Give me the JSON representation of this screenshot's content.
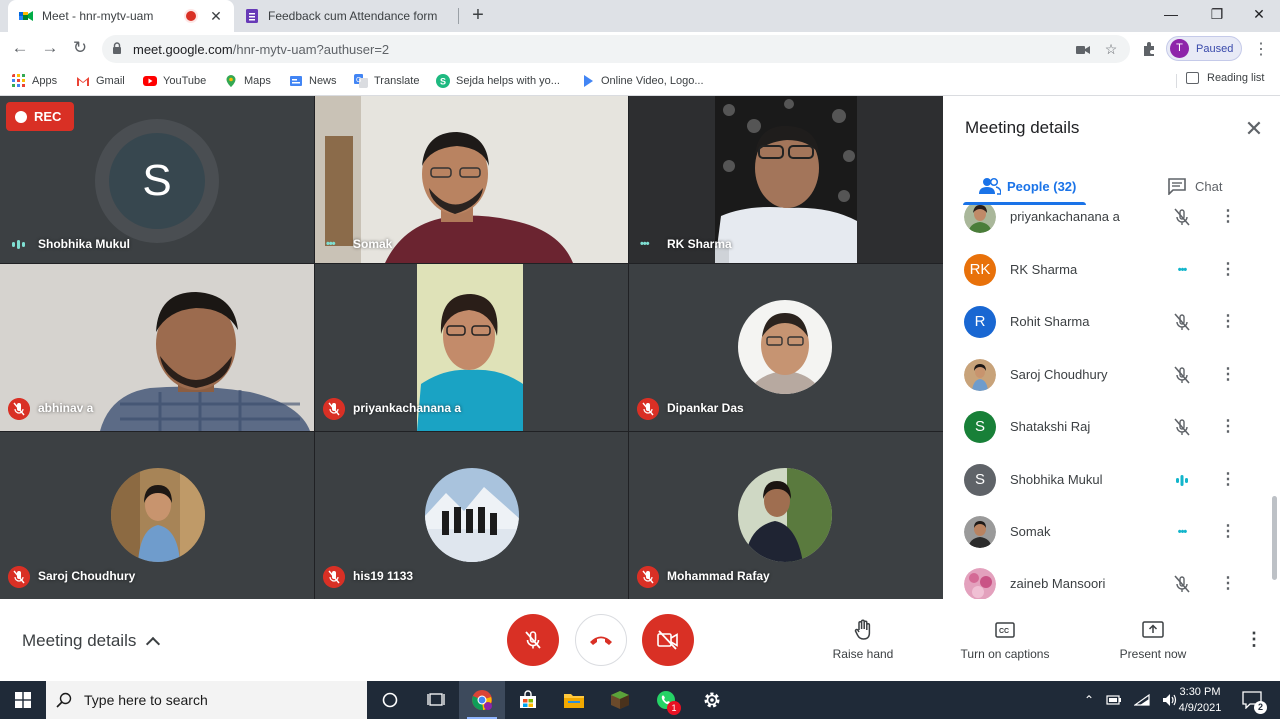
{
  "browser": {
    "tabs": [
      {
        "title": "Meet - hnr-mytv-uam",
        "recording": true
      },
      {
        "title": "Feedback cum Attendance form"
      }
    ],
    "url_host": "meet.google.com",
    "url_path": "/hnr-mytv-uam?authuser=2",
    "profile_initial": "T",
    "profile_status": "Paused",
    "bookmarks": [
      {
        "label": "Apps",
        "icon": "apps-grid-icon"
      },
      {
        "label": "Gmail",
        "icon": "gmail-icon"
      },
      {
        "label": "YouTube",
        "icon": "youtube-icon"
      },
      {
        "label": "Maps",
        "icon": "maps-pin-icon"
      },
      {
        "label": "News",
        "icon": "news-icon"
      },
      {
        "label": "Translate",
        "icon": "translate-icon"
      },
      {
        "label": "Sejda helps with yo...",
        "icon": "sejda-icon"
      },
      {
        "label": "Online Video, Logo...",
        "icon": "play-icon"
      }
    ],
    "reading_list": "Reading list"
  },
  "meet": {
    "rec_label": "REC",
    "tiles": [
      {
        "name": "Shobhika Mukul",
        "initial": "S",
        "status": "speaking"
      },
      {
        "name": "Somak",
        "status": "dots"
      },
      {
        "name": "RK Sharma",
        "status": "dots"
      },
      {
        "name": "abhinav a",
        "status": "muted"
      },
      {
        "name": "priyankachanana a",
        "status": "muted"
      },
      {
        "name": "Dipankar Das",
        "status": "muted"
      },
      {
        "name": "Saroj Choudhury",
        "status": "muted"
      },
      {
        "name": "his19 1133",
        "status": "muted"
      },
      {
        "name": "Mohammad Rafay",
        "status": "muted"
      }
    ]
  },
  "panel": {
    "title": "Meeting details",
    "tab_people": "People (32)",
    "tab_chat": "Chat",
    "people": [
      {
        "name": "priyankachanana a",
        "initial": "",
        "color": "#7a8a6a",
        "status": "muted"
      },
      {
        "name": "RK Sharma",
        "initial": "RK",
        "color": "#e8710a",
        "status": "dots"
      },
      {
        "name": "Rohit Sharma",
        "initial": "R",
        "color": "#1967d2",
        "status": "muted"
      },
      {
        "name": "Saroj Choudhury",
        "initial": "",
        "color": "#c8a37a",
        "status": "muted"
      },
      {
        "name": "Shatakshi Raj",
        "initial": "S",
        "color": "#188038",
        "status": "muted"
      },
      {
        "name": "Shobhika Mukul",
        "initial": "S",
        "color": "#5f6368",
        "status": "speaking"
      },
      {
        "name": "Somak",
        "initial": "",
        "color": "#4a4a4a",
        "status": "dots"
      },
      {
        "name": "zaineb Mansoori",
        "initial": "",
        "color": "#d97ba0",
        "status": "muted"
      }
    ]
  },
  "controls": {
    "meeting_details": "Meeting details",
    "raise_hand": "Raise hand",
    "captions": "Turn on captions",
    "present": "Present now"
  },
  "taskbar": {
    "search_placeholder": "Type here to search",
    "time": "3:30 PM",
    "date": "4/9/2021",
    "notification_count": "2",
    "whatsapp_badge": "1"
  }
}
